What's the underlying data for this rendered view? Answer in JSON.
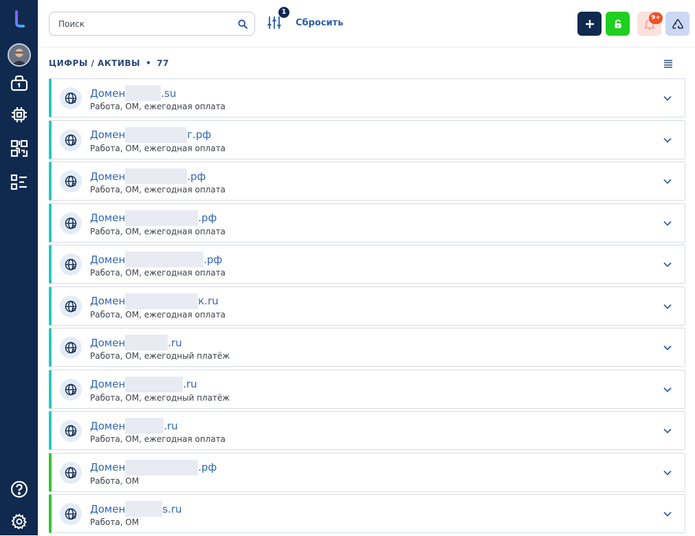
{
  "sidebar": {
    "items": [
      {
        "name": "logo",
        "icon": "logo-t-icon"
      },
      {
        "name": "avatar",
        "icon": "user-avatar"
      },
      {
        "name": "assets",
        "icon": "briefcase-icon"
      },
      {
        "name": "hardware",
        "icon": "chip-icon"
      },
      {
        "name": "qr",
        "icon": "qr-code-icon"
      },
      {
        "name": "lists",
        "icon": "checklist-icon"
      },
      {
        "name": "help",
        "icon": "help-circle-icon"
      },
      {
        "name": "settings",
        "icon": "gear-icon"
      }
    ]
  },
  "topbar": {
    "search_placeholder": "Поиск",
    "filter_count": "1",
    "reset_label": "Сбросить",
    "notifications_badge": "9+",
    "colors": {
      "add": "#10294f",
      "lock": "#1fcf1f",
      "bell": "#fbe2dd",
      "recycle": "#ccd7f3"
    }
  },
  "section": {
    "title": "ЦИФРЫ / АКТИВЫ",
    "separator": "•",
    "count": "77"
  },
  "items": [
    {
      "prefix": "Домен",
      "suffix": ".su",
      "subtitle": "Работа, ОМ, ежегодная оплата",
      "accent": "teal"
    },
    {
      "prefix": "Домен",
      "suffix": "г.рф",
      "subtitle": "Работа, ОМ, ежегодная оплата",
      "accent": "teal"
    },
    {
      "prefix": "Домен",
      "suffix": ".рф",
      "subtitle": "Работа, ОМ, ежегодная оплата",
      "accent": "teal"
    },
    {
      "prefix": "Домен",
      "suffix": ".рф",
      "subtitle": "Работа, ОМ, ежегодная оплата",
      "accent": "teal"
    },
    {
      "prefix": "Домен",
      "suffix": ".рф",
      "subtitle": "Работа, ОМ, ежегодная оплата",
      "accent": "teal"
    },
    {
      "prefix": "Домен",
      "suffix": "к.ru",
      "subtitle": "Работа, ОМ, ежегодная оплата",
      "accent": "teal"
    },
    {
      "prefix": "Домен",
      "suffix": ".ru",
      "subtitle": "Работа, ОМ, ежегодный платёж",
      "accent": "teal"
    },
    {
      "prefix": "Домен",
      "suffix": ".ru",
      "subtitle": "Работа, ОМ, ежегодный платёж",
      "accent": "teal"
    },
    {
      "prefix": "Домен",
      "suffix": ".ru",
      "subtitle": "Работа, ОМ, ежегодная оплата",
      "accent": "teal"
    },
    {
      "prefix": "Домен",
      "suffix": ".рф",
      "subtitle": "Работа, ОМ",
      "accent": "green"
    },
    {
      "prefix": "Домен",
      "suffix": "s.ru",
      "subtitle": "Работа, ОМ",
      "accent": "green"
    }
  ]
}
